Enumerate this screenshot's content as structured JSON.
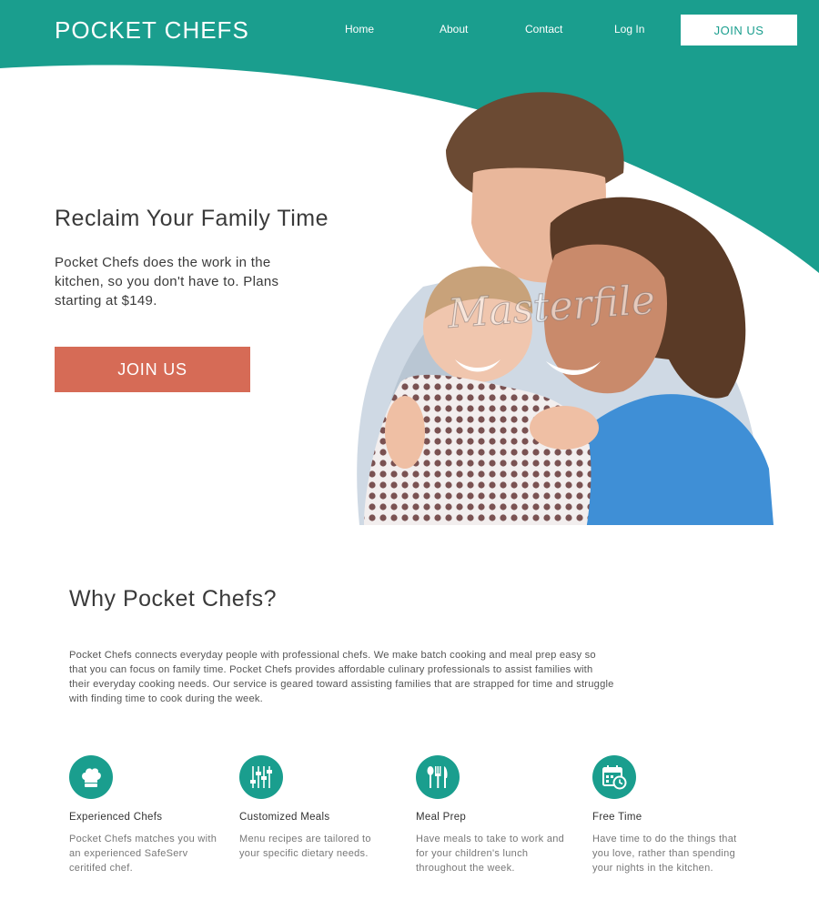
{
  "header": {
    "logo": "POCKET CHEFS",
    "nav": [
      {
        "label": "Home"
      },
      {
        "label": "About"
      },
      {
        "label": "Contact"
      },
      {
        "label": "Log In"
      }
    ],
    "join_label": "JOIN US"
  },
  "hero": {
    "title": "Reclaim Your Family Time",
    "text": "Pocket Chefs does the work in the kitchen, so you don't have to. Plans starting at $149.",
    "join_label": "JOIN US",
    "watermark": "Masterfile"
  },
  "why": {
    "title": "Why Pocket Chefs?",
    "text": "Pocket Chefs connects everyday people with professional chefs. We make batch cooking and meal prep easy so that you can focus on family time. Pocket Chefs provides affordable culinary professionals to assist families with their everyday cooking needs. Our service is geared toward assisting families that are strapped for time and struggle with finding time to cook during the week."
  },
  "features": [
    {
      "icon": "chef-hat-icon",
      "title": "Experienced Chefs",
      "text": "Pocket Chefs matches you with an experienced SafeServ ceritifed chef."
    },
    {
      "icon": "sliders-icon",
      "title": "Customized Meals",
      "text": "Menu recipes are tailored to your specific dietary needs."
    },
    {
      "icon": "utensils-icon",
      "title": "Meal Prep",
      "text": "Have meals to take to work and for your children's lunch throughout the week."
    },
    {
      "icon": "calendar-clock-icon",
      "title": "Free Time",
      "text": "Have time to do the things that you love, rather than spending your nights in the kitchen."
    }
  ],
  "colors": {
    "teal": "#1a9e8e",
    "coral": "#d66b56"
  }
}
